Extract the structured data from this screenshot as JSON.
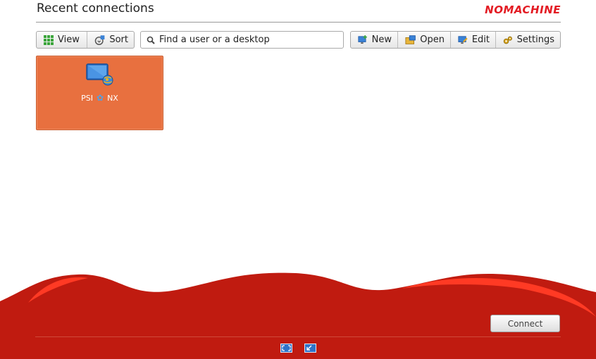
{
  "header": {
    "title": "Recent connections",
    "brand": "NOMACHINE"
  },
  "toolbar_left": [
    {
      "label": "View",
      "icon": "grid-icon"
    },
    {
      "label": "Sort",
      "icon": "sort-icon"
    }
  ],
  "search": {
    "placeholder": "Find a user or a desktop",
    "value": ""
  },
  "toolbar_right": [
    {
      "label": "New",
      "icon": "new-connection-icon"
    },
    {
      "label": "Open",
      "icon": "folder-open-icon"
    },
    {
      "label": "Edit",
      "icon": "edit-icon"
    },
    {
      "label": "Settings",
      "icon": "gear-icon"
    }
  ],
  "connections": [
    {
      "name_left": "PSI",
      "name_right": "NX",
      "selected": true
    }
  ],
  "footer": {
    "connect_label": "Connect",
    "fullscreen_icon": "fullscreen-icon",
    "window_icon": "window-mode-icon"
  },
  "colors": {
    "accent": "#e8703f",
    "brand_red": "#e31b23",
    "wave_red": "#c01b10"
  }
}
